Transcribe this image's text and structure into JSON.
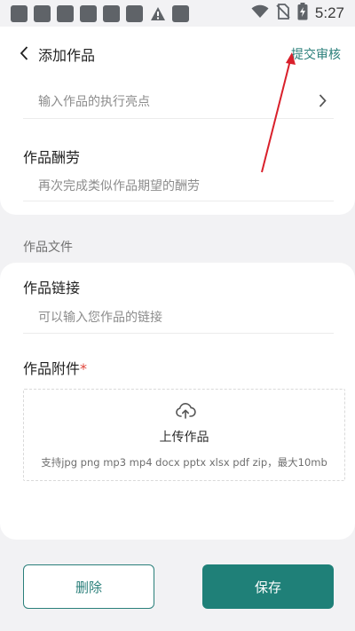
{
  "status_bar": {
    "time": "5:27",
    "icons": [
      "notification-icon",
      "notification-icon",
      "notification-icon",
      "notification-icon",
      "notification-icon",
      "notification-icon",
      "warning-icon",
      "notification-icon",
      "wifi-icon",
      "no-sim-icon",
      "battery-charging-icon"
    ]
  },
  "header": {
    "title": "添加作品",
    "submit_label": "提交审核"
  },
  "fields": {
    "highlight_placeholder": "输入作品的执行亮点",
    "reward_label": "作品酬劳",
    "reward_placeholder": "再次完成类似作品期望的酬劳"
  },
  "section": {
    "files_title": "作品文件"
  },
  "files": {
    "link_label": "作品链接",
    "link_placeholder": "可以输入您作品的链接",
    "attach_label": "作品附件",
    "required_mark": "*",
    "upload_title": "上传作品",
    "upload_hint": "支持jpg png mp3 mp4 docx pptx xlsx pdf zip，最大10mb"
  },
  "buttons": {
    "delete_label": "删除",
    "save_label": "保存"
  },
  "colors": {
    "accent": "#1f8078",
    "annotation_arrow": "#d9202b"
  }
}
